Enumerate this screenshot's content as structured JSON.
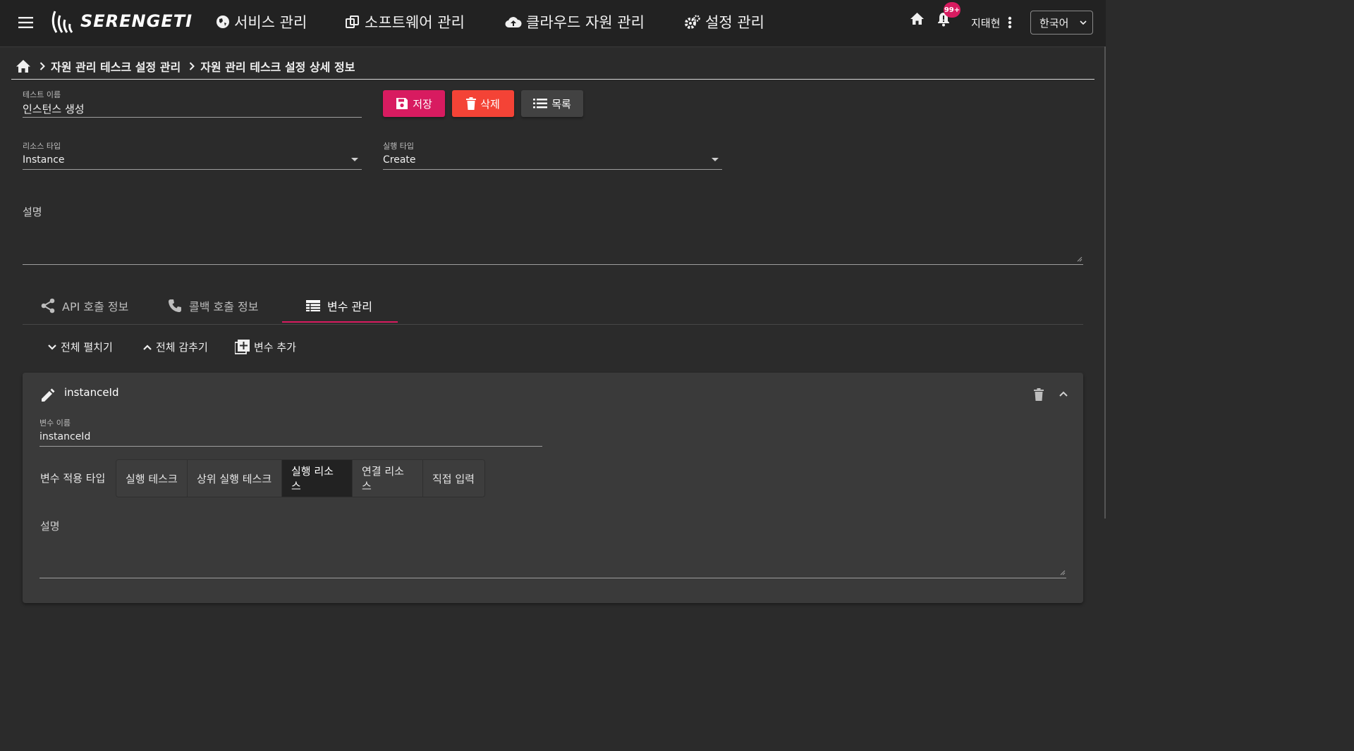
{
  "header": {
    "logo_text": "SERENGETI",
    "nav": [
      {
        "label": "서비스 관리",
        "icon": "globe-icon"
      },
      {
        "label": "소프트웨어 관리",
        "icon": "software-icon"
      },
      {
        "label": "클라우드 자원 관리",
        "icon": "cloud-upload-icon"
      },
      {
        "label": "설정 관리",
        "icon": "gears-icon"
      }
    ],
    "notification_badge": "99+",
    "user_name": "지태현",
    "language": "한국어"
  },
  "breadcrumb": {
    "items": [
      "자원 관리 테스크 설정 관리",
      "자원 관리 테스크 설정 상세 정보"
    ]
  },
  "form": {
    "test_name_label": "테스트 이름",
    "test_name_value": "인스턴스 생성",
    "resource_type_label": "리소스 타입",
    "resource_type_value": "Instance",
    "exec_type_label": "실행 타입",
    "exec_type_value": "Create",
    "description_label": "설명"
  },
  "actions": {
    "save_label": "저장",
    "delete_label": "삭제",
    "list_label": "목록"
  },
  "tabs": [
    {
      "label": "API 호출 정보",
      "icon": "share-icon"
    },
    {
      "label": "콜백 호출 정보",
      "icon": "phone-icon"
    },
    {
      "label": "변수 관리",
      "icon": "table-icon",
      "active": true
    }
  ],
  "toolbar": {
    "expand_all": "전체 펼치기",
    "collapse_all": "전체 감추기",
    "add_variable": "변수 추가"
  },
  "variable": {
    "title": "instanceId",
    "name_label": "변수 이름",
    "name_value": "instanceId",
    "apply_type_label": "변수 적용 타입",
    "apply_types": [
      "실행 테스크",
      "상위 실행 테스크",
      "실행 리소스",
      "연결 리소스",
      "직접 입력"
    ],
    "apply_type_selected": "실행 리소스",
    "description_label": "설명"
  },
  "colors": {
    "accent": "#d81b60",
    "save_button": "#d81b60",
    "delete_button": "#f44336",
    "list_button": "#424242"
  }
}
